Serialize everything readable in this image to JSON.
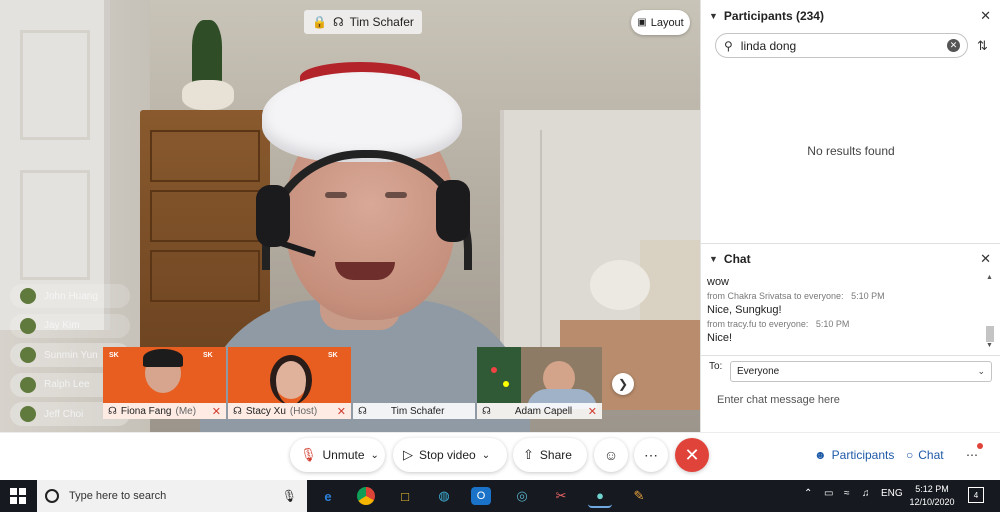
{
  "video": {
    "presenter_name": "Tim Schafer",
    "layout_label": "Layout",
    "faded_participants": [
      "John Huang",
      "Jay Kim",
      "Sunmin Yun",
      "Ralph Lee",
      "Jeff Choi"
    ],
    "thumbnails": [
      {
        "name": "Fiona Fang",
        "tag": "(Me)",
        "brand": "SK"
      },
      {
        "name": "Stacy Xu",
        "tag": "(Host)",
        "brand": "SK"
      },
      {
        "name": "Tim Schafer",
        "tag": ""
      },
      {
        "name": "Adam Capell",
        "tag": ""
      }
    ]
  },
  "participants": {
    "title": "Participants (234)",
    "search_value": "linda dong",
    "empty_text": "No results found"
  },
  "chat": {
    "title": "Chat",
    "messages": [
      {
        "text": "wow"
      },
      {
        "meta": "from Chakra Srivatsa to everyone:",
        "time": "5:10 PM",
        "text": "Nice, Sungkug!"
      },
      {
        "meta": "from tracy.fu to everyone:",
        "time": "5:10 PM",
        "text": "Nice!"
      }
    ],
    "to_label": "To:",
    "to_value": "Everyone",
    "input_placeholder": "Enter chat message here"
  },
  "controls": {
    "unmute": "Unmute",
    "stop_video": "Stop video",
    "share": "Share",
    "participants": "Participants",
    "chat": "Chat"
  },
  "taskbar": {
    "search_placeholder": "Type here to search",
    "lang": "ENG",
    "time": "5:12 PM",
    "date": "12/10/2020",
    "notif_count": "4"
  },
  "colors": {
    "end_call": "#e0433a",
    "accent_blue": "#1f5aa8",
    "thumbnail_orange": "#e85e20"
  }
}
